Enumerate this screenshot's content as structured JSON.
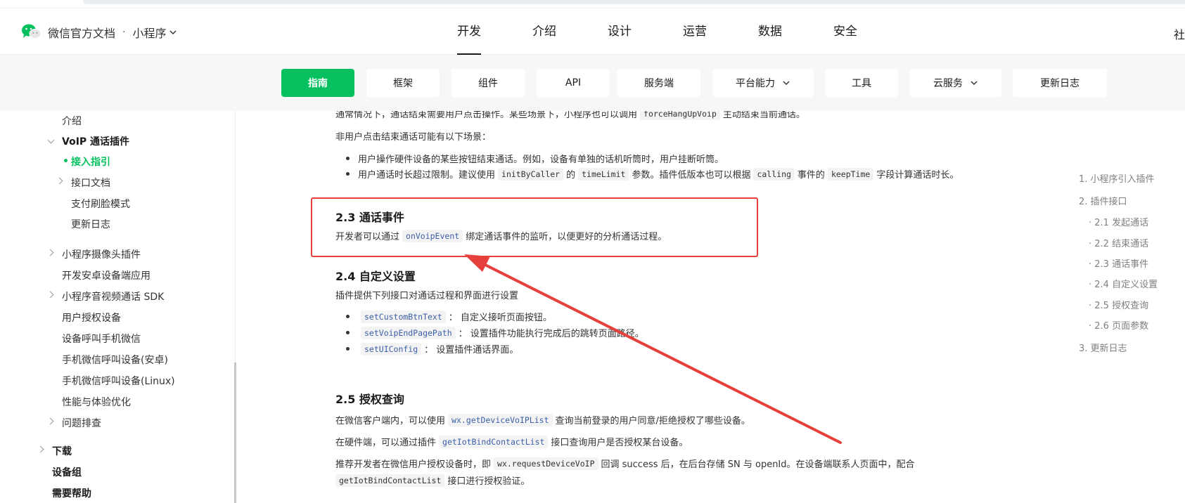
{
  "header": {
    "brand": "微信官方文档",
    "separator": "·",
    "product": "小程序",
    "nav": [
      "开发",
      "介绍",
      "设计",
      "运营",
      "数据",
      "安全"
    ],
    "right_text": "社"
  },
  "subnav": {
    "items": [
      "指南",
      "框架",
      "组件",
      "API",
      "服务端",
      "平台能力",
      "工具",
      "云服务",
      "更新日志"
    ]
  },
  "sidebar": {
    "items": [
      "介绍",
      "VoIP 通话插件",
      "接入指引",
      "接口文档",
      "支付刷脸模式",
      "更新日志",
      "小程序摄像头插件",
      "开发安卓设备端应用",
      "小程序音视频通话 SDK",
      "用户授权设备",
      "设备呼叫手机微信",
      "手机微信呼叫设备(安卓)",
      "手机微信呼叫设备(Linux)",
      "性能与体验优化",
      "问题排查",
      "下载",
      "设备组",
      "需要帮助"
    ]
  },
  "content": {
    "line0_a": "通常情况下，通话结束需要用户点击操作。某些场景下，小程序也可以调用",
    "line0_code": "forceHangUpVoip",
    "line0_b": "主动结束当前通话。",
    "line1": "非用户点击结束通话可能有以下场景：",
    "bullet1": "用户操作硬件设备的某些按钮结束通话。例如，设备有单独的话机听筒时，用户挂断听筒。",
    "bullet2_a": "用户通话时长超过限制。建议使用",
    "bullet2_code1": "initByCaller",
    "bullet2_b": "的",
    "bullet2_code2": "timeLimit",
    "bullet2_c": "参数。插件低版本也可以根据",
    "bullet2_code3": "calling",
    "bullet2_d": "事件的",
    "bullet2_code4": "keepTime",
    "bullet2_e": "字段计算通话时长。",
    "h23": "2.3 通话事件",
    "p23_a": "开发者可以通过",
    "p23_code": "onVoipEvent",
    "p23_b": "绑定通话事件的监听，以便更好的分析通话过程。",
    "h24": "2.4 自定义设置",
    "p24": "插件提供下列接口对通话过程和界面进行设置",
    "b24_1_code": "setCustomBtnText",
    "b24_1_text": "： 自定义接听页面按钮。",
    "b24_2_code": "setVoipEndPagePath",
    "b24_2_text": "： 设置插件功能执行完成后的跳转页面路径。",
    "b24_3_code": "setUIConfig",
    "b24_3_text": "： 设置插件通话界面。",
    "h25": "2.5 授权查询",
    "p25_1a": "在微信客户端内，可以使用",
    "p25_1code": "wx.getDeviceVoIPList",
    "p25_1b": "查询当前登录的用户同意/拒绝授权了哪些设备。",
    "p25_2a": "在硬件端，可以通过插件",
    "p25_2code": "getIotBindContactList",
    "p25_2b": "接口查询用户是否授权某台设备。",
    "p25_3a": "推荐开发者在微信用户授权设备时，即",
    "p25_3code": "wx.requestDeviceVoIP",
    "p25_3b": "回调 success 后，在后台存储 SN 与 openId。在设备端联系人页面中，配合",
    "p25_4code": "getIotBindContactList",
    "p25_4b": "接口进行授权验证。"
  },
  "toc": {
    "items": [
      "1. 小程序引入插件",
      "2. 插件接口",
      "· 2.1 发起通话",
      "· 2.2 结束通话",
      "· 2.3 通话事件",
      "· 2.4 自定义设置",
      "· 2.5 授权查询",
      "· 2.6 页面参数",
      "3. 更新日志"
    ]
  },
  "colors": {
    "accent": "#07c160",
    "annotation": "#e5403b"
  }
}
